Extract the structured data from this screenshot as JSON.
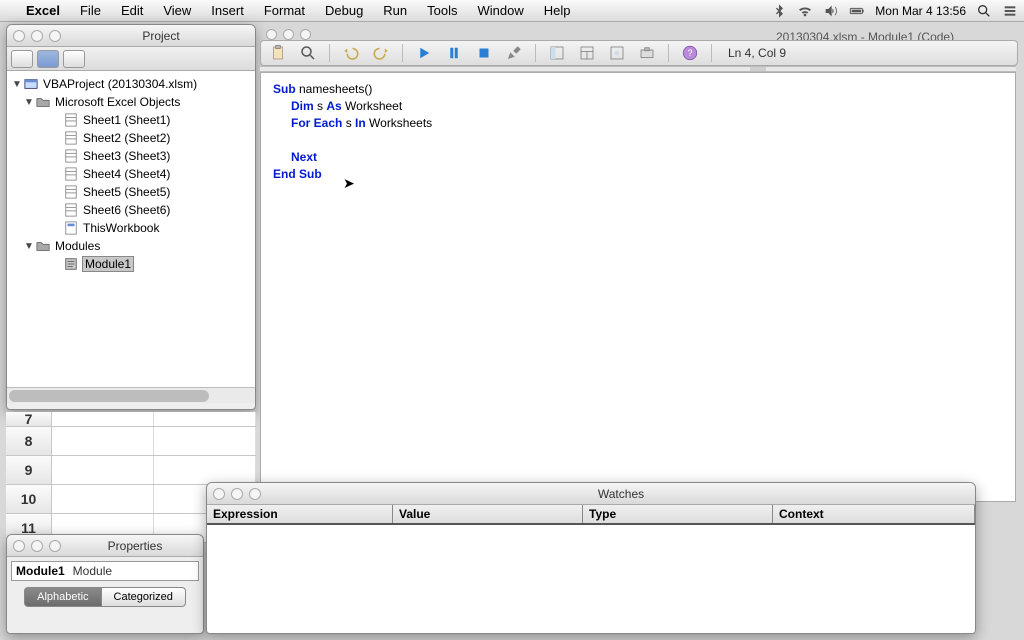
{
  "menubar": {
    "app": "Excel",
    "items": [
      "File",
      "Edit",
      "View",
      "Insert",
      "Format",
      "Debug",
      "Run",
      "Tools",
      "Window",
      "Help"
    ],
    "clock": "Mon Mar 4  13:56"
  },
  "project": {
    "title": "Project",
    "root": "VBAProject (20130304.xlsm)",
    "excel_objects_label": "Microsoft Excel Objects",
    "sheets": [
      "Sheet1 (Sheet1)",
      "Sheet2 (Sheet2)",
      "Sheet3 (Sheet3)",
      "Sheet4 (Sheet4)",
      "Sheet5 (Sheet5)",
      "Sheet6 (Sheet6)"
    ],
    "this_workbook": "ThisWorkbook",
    "modules_label": "Modules",
    "module_item": "Module1"
  },
  "code": {
    "tab_title": "20130304.xlsm - Module1 (Code)",
    "status": "Ln 4, Col 9",
    "line1_a": "Sub ",
    "line1_b": "namesheets()",
    "line2_a": "Dim ",
    "line2_b": "s ",
    "line2_c": "As ",
    "line2_d": "Worksheet",
    "line3_a": "For Each ",
    "line3_b": "s ",
    "line3_c": "In ",
    "line3_d": "Worksheets",
    "line4": "",
    "line5": "Next",
    "line6": "End Sub"
  },
  "sheet_rows": [
    "7",
    "8",
    "9",
    "10",
    "11"
  ],
  "properties": {
    "title": "Properties",
    "name": "Module1",
    "type": "Module",
    "tabs": [
      "Alphabetic",
      "Categorized"
    ]
  },
  "watches": {
    "title": "Watches",
    "columns": [
      "Expression",
      "Value",
      "Type",
      "Context"
    ]
  }
}
